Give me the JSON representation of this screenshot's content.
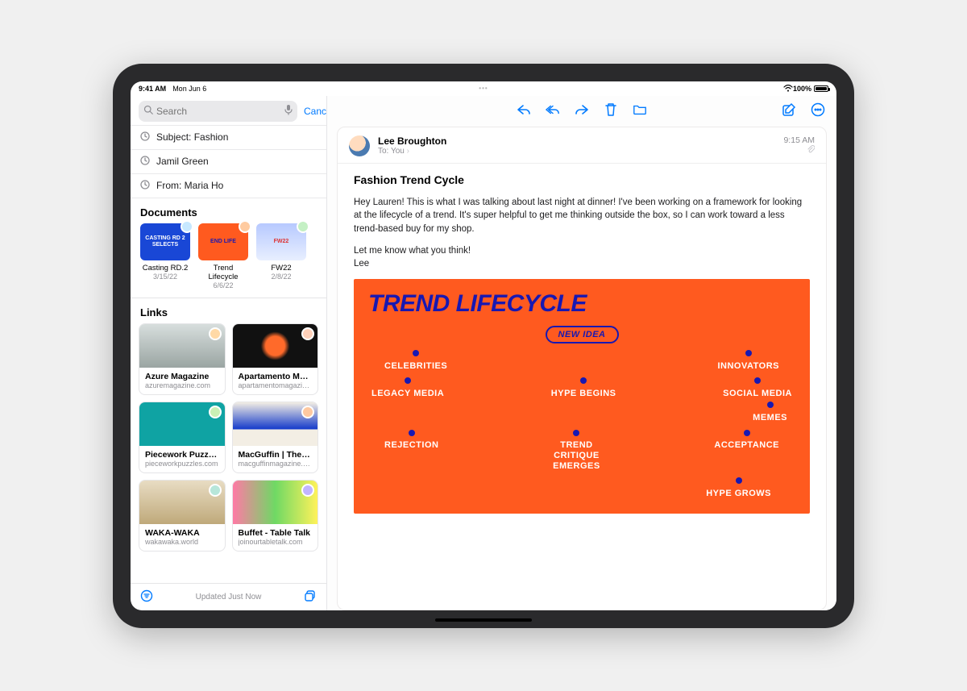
{
  "status": {
    "time": "9:41 AM",
    "date": "Mon Jun 6",
    "battery_pct": "100%"
  },
  "sidebar": {
    "search_placeholder": "Search",
    "cancel": "Cancel",
    "suggest": [
      "Subject: Fashion",
      "Jamil Green",
      "From: Maria Ho"
    ],
    "documents_header": "Documents",
    "documents": [
      {
        "title": "Casting RD.2",
        "date": "3/15/22",
        "thumb_color": "#1947d6",
        "thumb_text": "CASTING RD 2 SELECTS"
      },
      {
        "title": "Trend Lifecycle",
        "date": "6/6/22",
        "thumb_color": "#ff5a1f",
        "thumb_text": "END LIFE"
      },
      {
        "title": "FW22",
        "date": "2/8/22",
        "thumb_color": "#cfd9ff",
        "thumb_text": "FW22"
      }
    ],
    "links_header": "Links",
    "links": [
      {
        "title": "Azure Magazine",
        "url": "azuremagazine.com",
        "bg": "#b9c6c4"
      },
      {
        "title": "Apartamento Maga…",
        "url": "apartamentomagazine.c…",
        "bg": "#141414"
      },
      {
        "title": "Piecework Puzzles",
        "url": "pieceworkpuzzles.com",
        "bg": "#0fa3a3"
      },
      {
        "title": "MacGuffin | The Lif…",
        "url": "macguffinmagazine.com",
        "bg": "#efe9de"
      },
      {
        "title": "WAKA-WAKA",
        "url": "wakawaka.world",
        "bg": "#d9c7a6"
      },
      {
        "title": "Buffet - Table Talk",
        "url": "joinourtabletalk.com",
        "bg": "#d9f0d2"
      }
    ],
    "updated": "Updated Just Now"
  },
  "message": {
    "sender": "Lee Broughton",
    "to_label": "To:",
    "to_value": "You",
    "time": "9:15 AM",
    "subject": "Fashion Trend Cycle",
    "body_p1": "Hey Lauren! This is what I was talking about last night at dinner! I've been working on a framework for looking at the lifecycle of a trend. It's super helpful to get me thinking outside the box, so I can work toward a less trend-based buy for my shop.",
    "body_p2": "Let me know what you think!",
    "body_sig": "Lee"
  },
  "attachment": {
    "title": "TREND LIFECYCLE",
    "new_idea": "NEW IDEA",
    "celebrities": "CELEBRITIES",
    "innovators": "INNOVATORS",
    "legacy_media": "LEGACY MEDIA",
    "hype_begins": "HYPE BEGINS",
    "social_media": "SOCIAL MEDIA",
    "memes": "MEMES",
    "rejection": "REJECTION",
    "trend_critique": "TREND CRITIQUE EMERGES",
    "acceptance": "ACCEPTANCE",
    "hype_grows": "HYPE GROWS"
  }
}
